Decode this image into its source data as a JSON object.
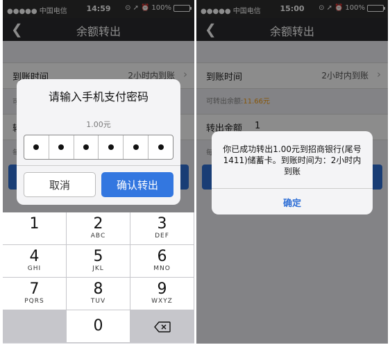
{
  "left": {
    "status": {
      "carrier": "●●●●● 中国电信",
      "time": "14:59",
      "battery": "100%"
    },
    "nav": {
      "title": "余额转出"
    },
    "row1": {
      "label": "到账时间",
      "value": "2小时内到账"
    },
    "note_prefix": "可",
    "row2": {
      "label": "转"
    },
    "note2": "每",
    "dialog": {
      "title": "请输入手机支付密码",
      "amount": "1.00元",
      "pin_length": 6,
      "cancel_label": "取消",
      "confirm_label": "确认转出"
    },
    "keypad": [
      {
        "num": "1",
        "letters": ""
      },
      {
        "num": "2",
        "letters": "ABC"
      },
      {
        "num": "3",
        "letters": "DEF"
      },
      {
        "num": "4",
        "letters": "GHI"
      },
      {
        "num": "5",
        "letters": "JKL"
      },
      {
        "num": "6",
        "letters": "MNO"
      },
      {
        "num": "7",
        "letters": "PQRS"
      },
      {
        "num": "8",
        "letters": "TUV"
      },
      {
        "num": "9",
        "letters": "WXYZ"
      },
      {
        "num": "0",
        "letters": ""
      }
    ],
    "delete_icon": "backspace-icon"
  },
  "right": {
    "status": {
      "carrier": "●●●●● 中国电信",
      "time": "15:00",
      "battery": "100%"
    },
    "nav": {
      "title": "余额转出"
    },
    "row1": {
      "label": "到账时间",
      "value": "2小时内到账"
    },
    "available": {
      "label": "可转出余额:",
      "amount": "11.66元"
    },
    "row2": {
      "label": "转出金额",
      "value": "1"
    },
    "note2": "每",
    "alert": {
      "message": "你已成功转出1.00元到招商银行(尾号1411)储蓄卡。到账时间为：2小时内到账",
      "ok_label": "确定"
    }
  },
  "colors": {
    "primary": "#3377e0",
    "nav": "#2a2a2e",
    "highlight": "#f39c12",
    "battery": "#4cd964"
  }
}
